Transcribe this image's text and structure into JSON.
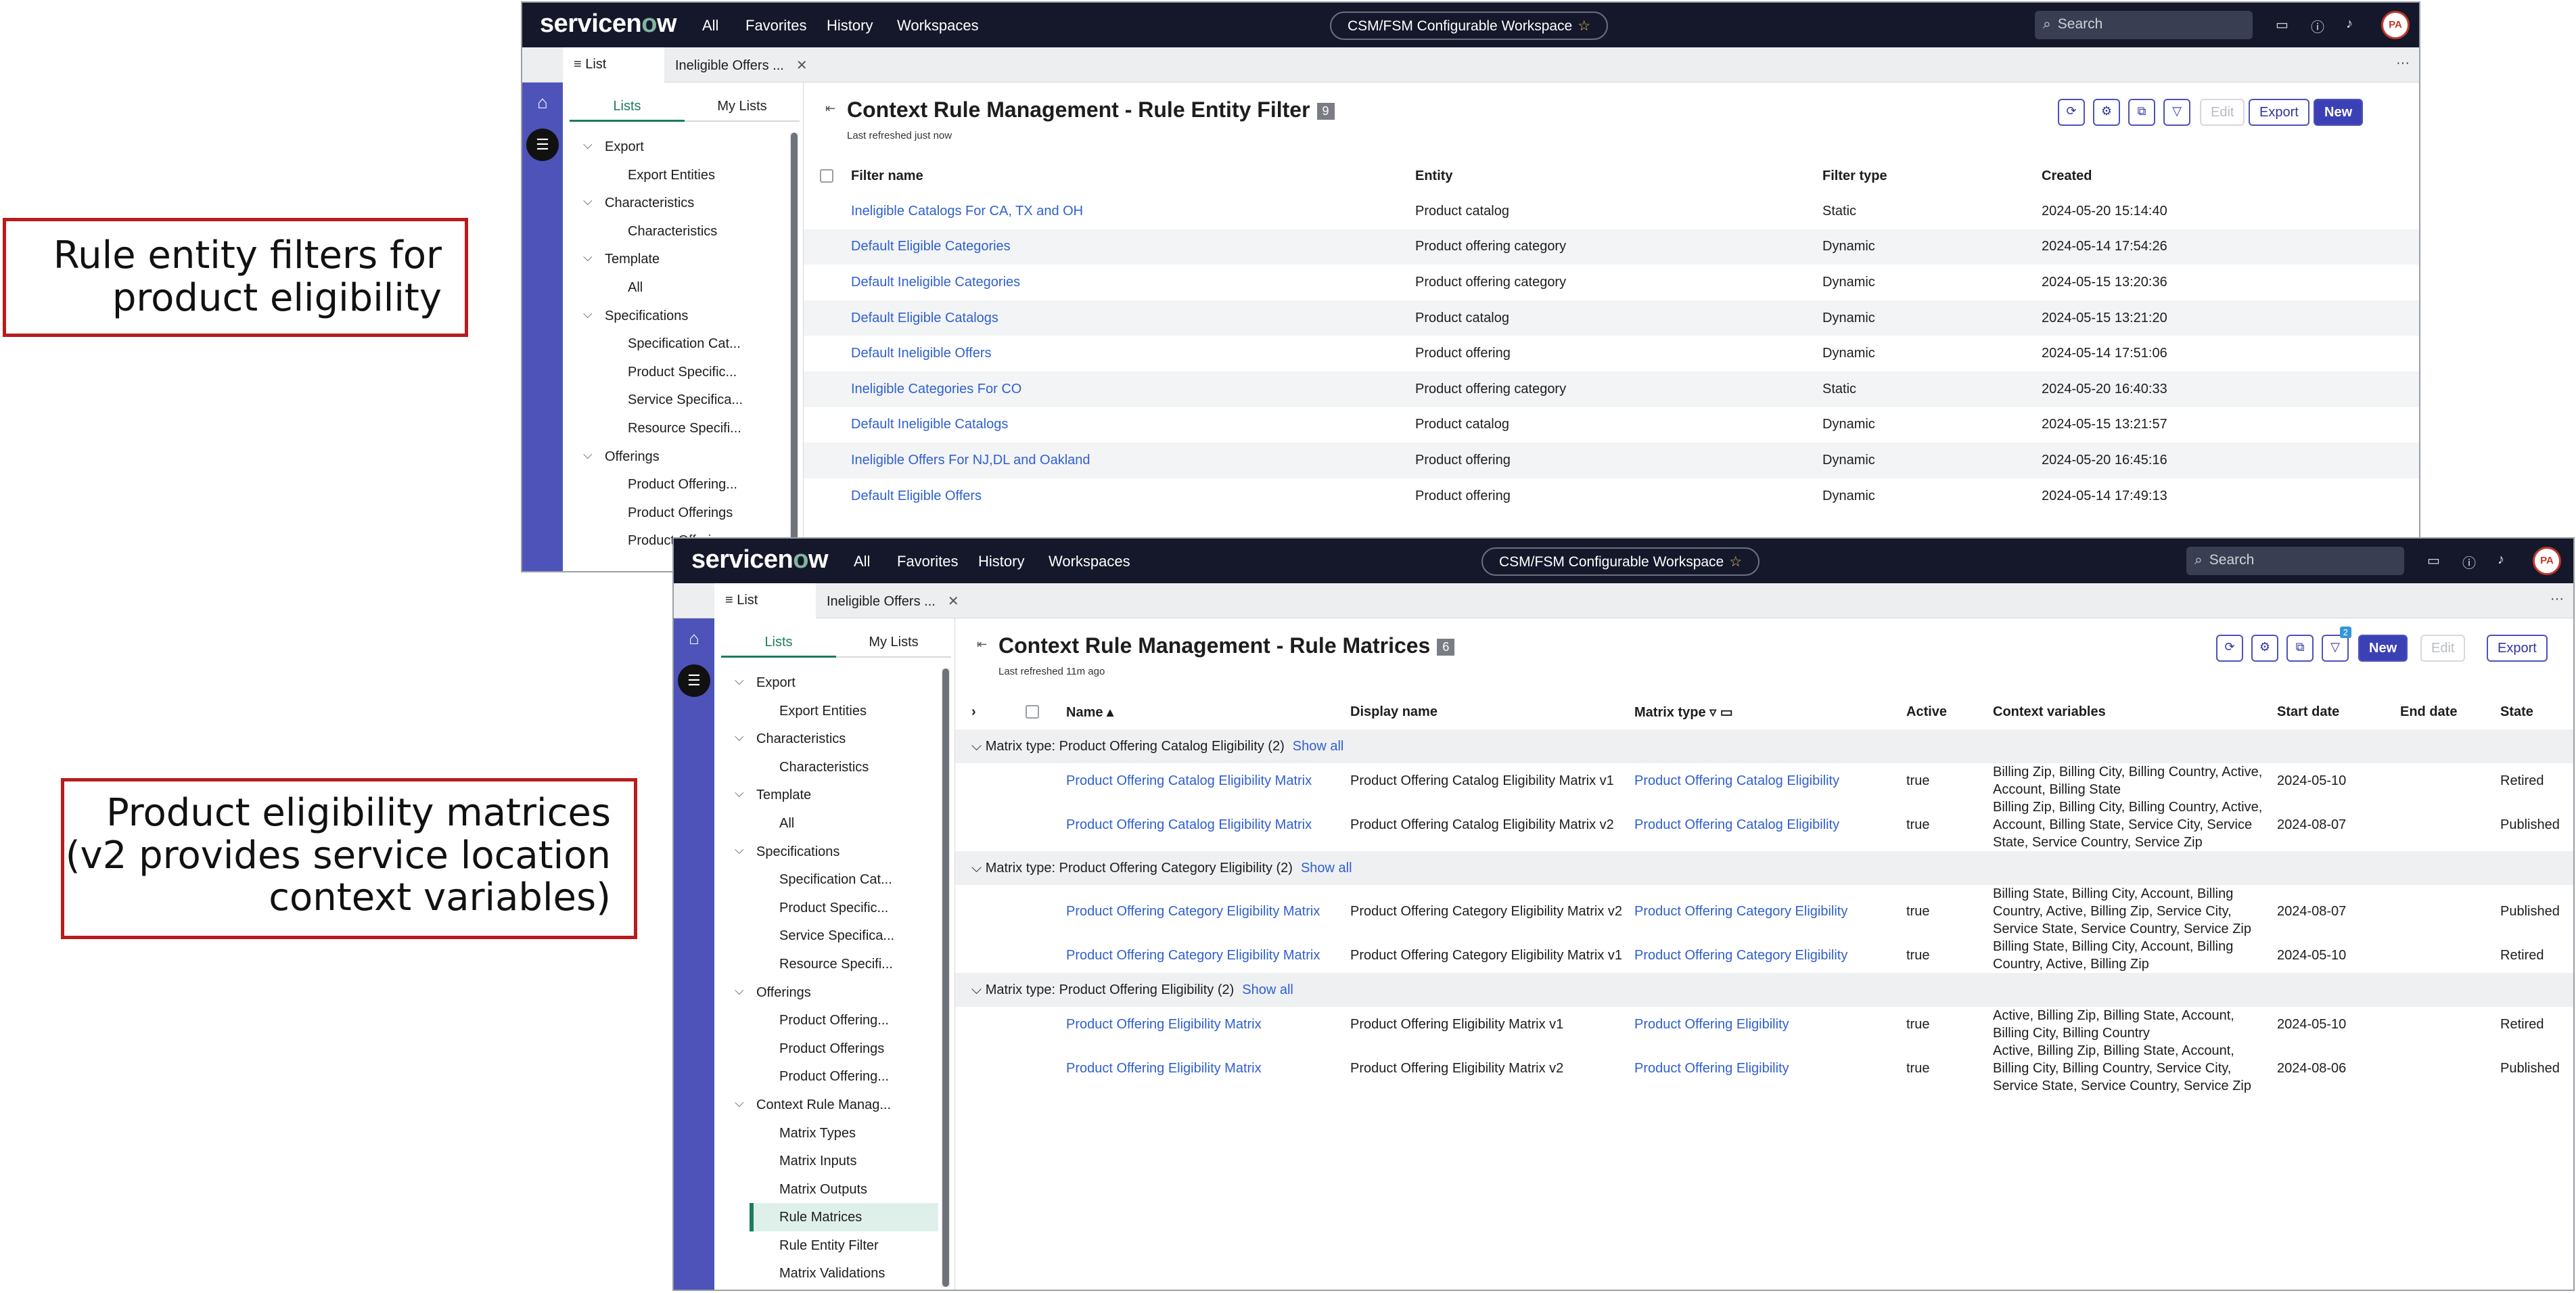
{
  "callouts": {
    "top": [
      "Rule entity filters for",
      "product eligibility"
    ],
    "bottom": [
      "Product eligibility matrices",
      "(v2 provides service location",
      "context variables)"
    ]
  },
  "nav": {
    "logo": "servicenow",
    "items": [
      "All",
      "Favorites",
      "History",
      "Workspaces"
    ],
    "workspace": "CSM/FSM Configurable Workspace",
    "search_placeholder": "Search",
    "avatar": "PA"
  },
  "sidebar": {
    "tabs": [
      "Lists",
      "My Lists"
    ],
    "tree1": [
      {
        "label": "Export",
        "level": 1
      },
      {
        "label": "Export Entities",
        "level": 2
      },
      {
        "label": "Characteristics",
        "level": 1
      },
      {
        "label": "Characteristics",
        "level": 2
      },
      {
        "label": "Template",
        "level": 1
      },
      {
        "label": "All",
        "level": 2
      },
      {
        "label": "Specifications",
        "level": 1
      },
      {
        "label": "Specification Cat...",
        "level": 2
      },
      {
        "label": "Product Specific...",
        "level": 2
      },
      {
        "label": "Service Specifica...",
        "level": 2
      },
      {
        "label": "Resource Specifi...",
        "level": 2
      },
      {
        "label": "Offerings",
        "level": 1
      },
      {
        "label": "Product Offering...",
        "level": 2
      },
      {
        "label": "Product Offerings",
        "level": 2
      },
      {
        "label": "Product Offering...",
        "level": 2
      }
    ],
    "tree2": [
      {
        "label": "Export",
        "level": 1
      },
      {
        "label": "Export Entities",
        "level": 2
      },
      {
        "label": "Characteristics",
        "level": 1
      },
      {
        "label": "Characteristics",
        "level": 2
      },
      {
        "label": "Template",
        "level": 1
      },
      {
        "label": "All",
        "level": 2
      },
      {
        "label": "Specifications",
        "level": 1
      },
      {
        "label": "Specification Cat...",
        "level": 2
      },
      {
        "label": "Product Specific...",
        "level": 2
      },
      {
        "label": "Service Specifica...",
        "level": 2
      },
      {
        "label": "Resource Specifi...",
        "level": 2
      },
      {
        "label": "Offerings",
        "level": 1
      },
      {
        "label": "Product Offering...",
        "level": 2
      },
      {
        "label": "Product Offerings",
        "level": 2
      },
      {
        "label": "Product Offering...",
        "level": 2
      },
      {
        "label": "Context Rule Manag...",
        "level": 1
      },
      {
        "label": "Matrix Types",
        "level": 2
      },
      {
        "label": "Matrix Inputs",
        "level": 2
      },
      {
        "label": "Matrix Outputs",
        "level": 2
      },
      {
        "label": "Rule Matrices",
        "level": 2,
        "selected": true
      },
      {
        "label": "Rule Entity Filter",
        "level": 2
      },
      {
        "label": "Matrix Validations",
        "level": 2
      }
    ]
  },
  "win1": {
    "tabs": [
      "List",
      "Ineligible Offers ..."
    ],
    "title": "Context Rule Management - Rule Entity Filter",
    "count": "9",
    "refreshed": "Last refreshed just now",
    "buttons": {
      "edit": "Edit",
      "export": "Export",
      "new": "New"
    },
    "columns": [
      "Filter name",
      "Entity",
      "Filter type",
      "Created"
    ],
    "rows": [
      [
        "Ineligible Catalogs For CA, TX and OH",
        "Product catalog",
        "Static",
        "2024-05-20 15:14:40"
      ],
      [
        "Default Eligible Categories",
        "Product offering category",
        "Dynamic",
        "2024-05-14 17:54:26"
      ],
      [
        "Default Ineligible Categories",
        "Product offering category",
        "Dynamic",
        "2024-05-15 13:20:36"
      ],
      [
        "Default Eligible Catalogs",
        "Product catalog",
        "Dynamic",
        "2024-05-15 13:21:20"
      ],
      [
        "Default Ineligible Offers",
        "Product offering",
        "Dynamic",
        "2024-05-14 17:51:06"
      ],
      [
        "Ineligible Categories For CO",
        "Product offering category",
        "Static",
        "2024-05-20 16:40:33"
      ],
      [
        "Default Ineligible Catalogs",
        "Product catalog",
        "Dynamic",
        "2024-05-15 13:21:57"
      ],
      [
        "Ineligible Offers For NJ,DL and Oakland",
        "Product offering",
        "Dynamic",
        "2024-05-20 16:45:16"
      ],
      [
        "Default Eligible Offers",
        "Product offering",
        "Dynamic",
        "2024-05-14 17:49:13"
      ]
    ]
  },
  "win2": {
    "tabs": [
      "List",
      "Ineligible Offers ..."
    ],
    "title": "Context Rule Management - Rule Matrices",
    "count": "6",
    "refreshed": "Last refreshed 11m ago",
    "filter_badge": "2",
    "buttons": {
      "new": "New",
      "edit": "Edit",
      "export": "Export"
    },
    "columns": [
      "Name",
      "Display name",
      "Matrix type",
      "Active",
      "Context variables",
      "Start date",
      "End date",
      "State"
    ],
    "show_all": "Show all",
    "groups": [
      {
        "label": "Matrix type: Product Offering Catalog Eligibility (2)",
        "rows": [
          {
            "name": "Product Offering Catalog Eligibility Matrix",
            "display": "Product Offering Catalog Eligibility Matrix v1",
            "type": "Product Offering Catalog Eligibility",
            "active": "true",
            "context": "Billing Zip, Billing City, Billing Country, Active, Account, Billing State",
            "start": "2024-05-10",
            "end": "",
            "state": "Retired"
          },
          {
            "name": "Product Offering Catalog Eligibility Matrix",
            "display": "Product Offering Catalog Eligibility Matrix v2",
            "type": "Product Offering Catalog Eligibility",
            "active": "true",
            "context": "Billing Zip, Billing City, Billing Country, Active, Account, Billing State, Service City, Service State, Service Country, Service Zip",
            "start": "2024-08-07",
            "end": "",
            "state": "Published"
          }
        ]
      },
      {
        "label": "Matrix type: Product Offering Category Eligibility (2)",
        "rows": [
          {
            "name": "Product Offering Category Eligibility Matrix",
            "display": "Product Offering Category Eligibility Matrix v2",
            "type": "Product Offering Category Eligibility",
            "active": "true",
            "context": "Billing State, Billing City, Account, Billing Country, Active, Billing Zip, Service City, Service State, Service Country, Service Zip",
            "start": "2024-08-07",
            "end": "",
            "state": "Published"
          },
          {
            "name": "Product Offering Category Eligibility Matrix",
            "display": "Product Offering Category Eligibility Matrix v1",
            "type": "Product Offering Category Eligibility",
            "active": "true",
            "context": "Billing State, Billing City, Account, Billing Country, Active, Billing Zip",
            "start": "2024-05-10",
            "end": "",
            "state": "Retired"
          }
        ]
      },
      {
        "label": "Matrix type: Product Offering Eligibility (2)",
        "rows": [
          {
            "name": "Product Offering Eligibility Matrix",
            "display": "Product Offering Eligibility Matrix v1",
            "type": "Product Offering Eligibility",
            "active": "true",
            "context": "Active, Billing Zip, Billing State, Account, Billing City, Billing Country",
            "start": "2024-05-10",
            "end": "",
            "state": "Retired"
          },
          {
            "name": "Product Offering Eligibility Matrix",
            "display": "Product Offering Eligibility Matrix v2",
            "type": "Product Offering Eligibility",
            "active": "true",
            "context": "Active, Billing Zip, Billing State, Account, Billing City, Billing Country, Service City, Service State, Service Country, Service Zip",
            "start": "2024-08-06",
            "end": "",
            "state": "Published"
          }
        ]
      }
    ]
  },
  "colors": {
    "nav_bg": "#15182b",
    "rail": "#4d53b8",
    "accent_green": "#1b7d5a",
    "link": "#2f5fd0",
    "callout_border": "#b91c1c"
  },
  "icons": [
    "home-icon",
    "list-icon",
    "search-icon",
    "star-icon",
    "chat-icon",
    "help-icon",
    "bell-icon",
    "refresh-icon",
    "gear-icon",
    "open-icon",
    "filter-icon",
    "chevron-down-icon",
    "more-icon"
  ]
}
